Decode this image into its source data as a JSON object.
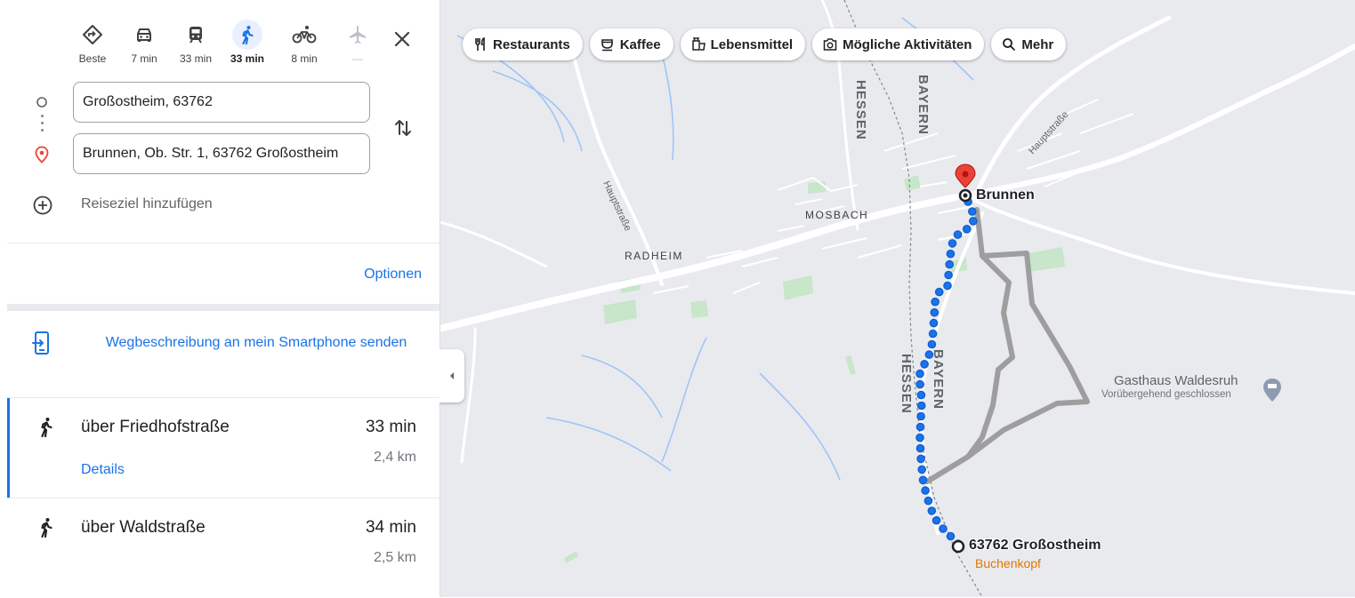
{
  "travel_modes": [
    {
      "name": "best",
      "label": "Beste",
      "icon": "best-route-icon",
      "active": false
    },
    {
      "name": "car",
      "label": "7 min",
      "icon": "car-icon",
      "active": false
    },
    {
      "name": "transit",
      "label": "33 min",
      "icon": "train-icon",
      "active": false
    },
    {
      "name": "walk",
      "label": "33 min",
      "icon": "walk-icon",
      "active": true
    },
    {
      "name": "bike",
      "label": "8 min",
      "icon": "bike-icon",
      "active": false
    },
    {
      "name": "flight",
      "label": "—",
      "icon": "plane-icon",
      "active": false
    }
  ],
  "directions": {
    "origin": "Großostheim, 63762",
    "destination": "Brunnen, Ob. Str. 1, 63762 Großostheim",
    "add_destination": "Reiseziel hinzufügen",
    "options": "Optionen",
    "send_to_phone": "Wegbeschreibung an mein Smartphone senden"
  },
  "routes": [
    {
      "name": "über Friedhofstraße",
      "time": "33 min",
      "distance": "2,4 km",
      "details": "Details",
      "selected": true
    },
    {
      "name": "über Waldstraße",
      "time": "34 min",
      "distance": "2,5 km",
      "selected": false
    }
  ],
  "map": {
    "chips": [
      {
        "label": "Restaurants",
        "icon": "restaurant-icon"
      },
      {
        "label": "Kaffee",
        "icon": "coffee-icon"
      },
      {
        "label": "Lebensmittel",
        "icon": "grocery-icon"
      },
      {
        "label": "Mögliche Aktivitäten",
        "icon": "camera-icon"
      },
      {
        "label": "Mehr",
        "icon": "search-icon"
      }
    ],
    "labels": {
      "mosbach": "MOSBACH",
      "radheim": "RADHEIM",
      "hessen": "HESSEN",
      "bayern": "BAYERN",
      "hauptstrasse": "Hauptstraße",
      "hauptstrasse_ne": "Hauptstraße",
      "brunnen": "Brunnen",
      "destination": "63762 Großostheim",
      "destination_sub": "Buchenkopf",
      "poi_name": "Gasthaus Waldesruh",
      "poi_status": "Vorübergehend geschlossen"
    },
    "colors": {
      "route_blue": "#1a73e8",
      "alt_route_gray": "#9e9e9e",
      "pin_red": "#ea4335",
      "poi_orange": "#e37400"
    }
  }
}
